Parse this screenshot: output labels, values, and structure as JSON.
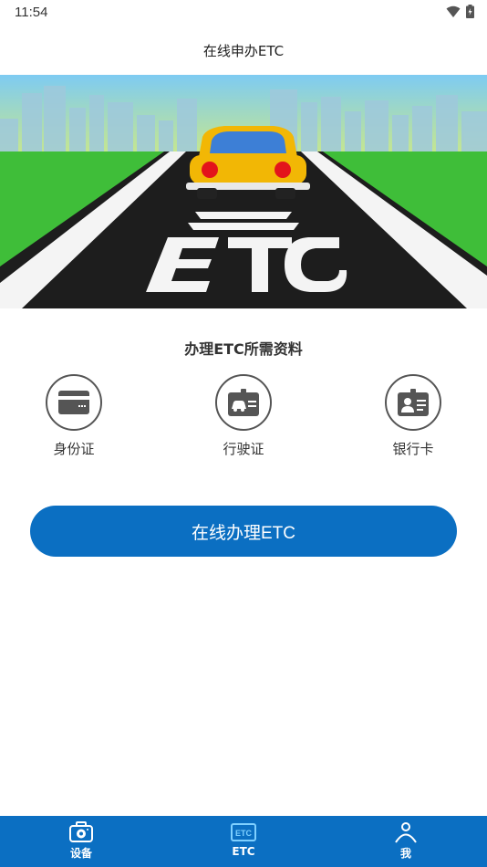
{
  "status_bar": {
    "time": "11:54"
  },
  "header": {
    "title": "在线申办ETC"
  },
  "banner": {
    "icon": "etc-road-illustration"
  },
  "materials": {
    "title": "办理ETC所需资料",
    "items": [
      {
        "label": "身份证",
        "icon": "id-card-icon"
      },
      {
        "label": "行驶证",
        "icon": "driving-license-icon"
      },
      {
        "label": "银行卡",
        "icon": "bank-card-icon"
      }
    ]
  },
  "apply_button": {
    "label": "在线办理ETC"
  },
  "bottom_nav": {
    "items": [
      {
        "label": "设备",
        "icon": "camera-icon"
      },
      {
        "label": "ETC",
        "icon": "etc-icon"
      },
      {
        "label": "我",
        "icon": "person-icon"
      }
    ]
  },
  "colors": {
    "primary": "#0b6fc2",
    "icon_bg": "#555555"
  }
}
